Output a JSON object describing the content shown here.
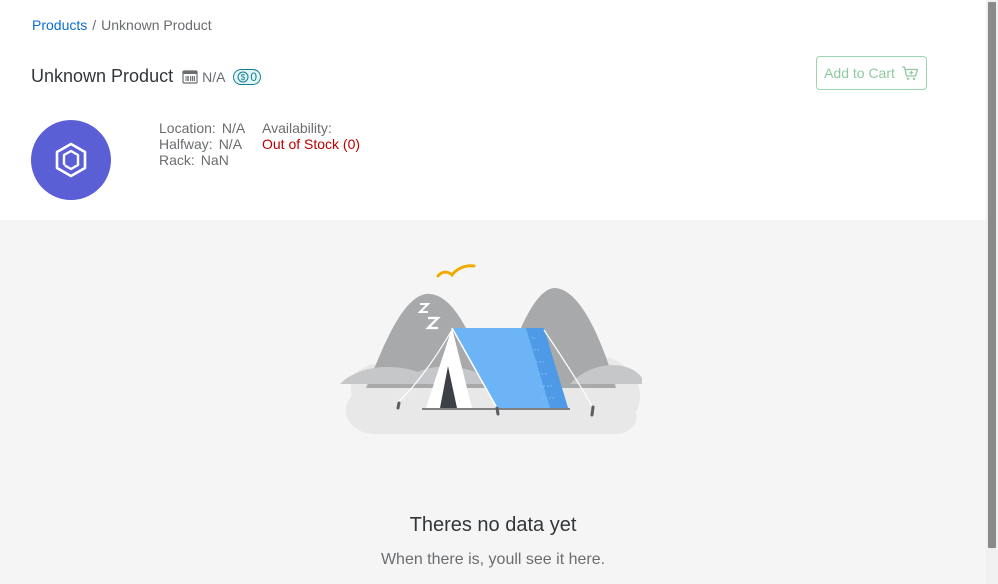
{
  "breadcrumb": {
    "link": "Products",
    "separator": "/",
    "current": "Unknown Product"
  },
  "product": {
    "title": "Unknown Product",
    "id_value": "N/A",
    "price_value": "0",
    "icons": {
      "id": "barcode-icon",
      "price": "dollar-icon",
      "avatar": "product-box-icon",
      "cart": "cart-icon"
    }
  },
  "actions": {
    "add_to_cart": "Add to Cart"
  },
  "details": {
    "location_label": "Location:",
    "location_value": "N/A",
    "halfway_label": "Halfway:",
    "halfway_value": "N/A",
    "rack_label": "Rack:",
    "rack_value": "NaN",
    "availability_label": "Availability:",
    "availability_value": "Out of Stock (0)"
  },
  "empty_state": {
    "title": "Theres no data yet",
    "subtitle": "When there is, youll see it here.",
    "illustration": "camping-tent-illustration"
  },
  "colors": {
    "link": "#0a6ed1",
    "avatar": "#5b5fd6",
    "out_of_stock": "#bb0000",
    "cart_button": "#8fc9a0",
    "price_badge": "#0f828f",
    "tent": "#6cb4f5"
  }
}
